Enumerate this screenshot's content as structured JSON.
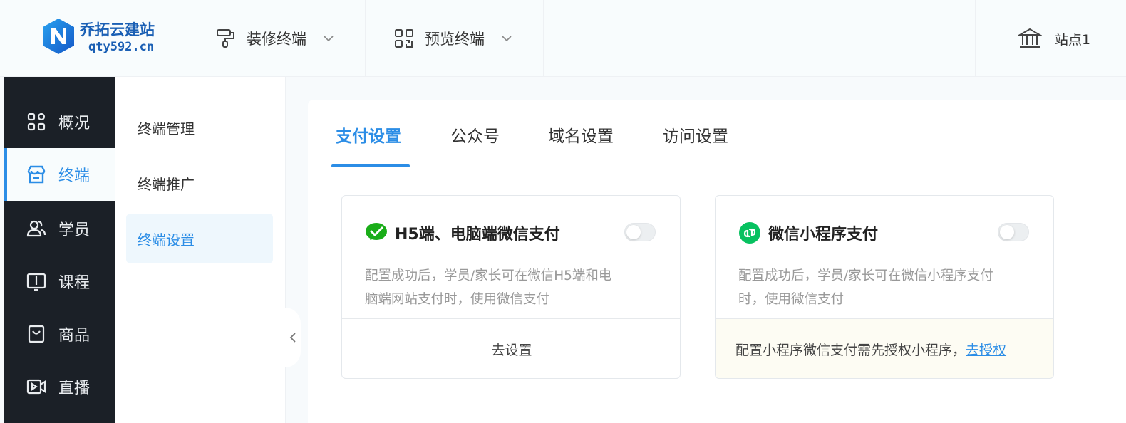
{
  "brand": {
    "title": "乔拓云建站",
    "url": "qty592.cn"
  },
  "header": {
    "menus": [
      {
        "label": "装修终端",
        "icon": "paint-roller-icon"
      },
      {
        "label": "预览终端",
        "icon": "qr-code-icon"
      }
    ],
    "site": {
      "label": "站点1",
      "icon": "bank-building-icon"
    }
  },
  "sidebar": {
    "items": [
      {
        "label": "概况",
        "icon": "dashboard-grid-icon"
      },
      {
        "label": "终端",
        "icon": "store-icon",
        "active": true
      },
      {
        "label": "学员",
        "icon": "users-icon"
      },
      {
        "label": "课程",
        "icon": "book-icon"
      },
      {
        "label": "商品",
        "icon": "shopping-bag-icon"
      },
      {
        "label": "直播",
        "icon": "video-camera-icon"
      }
    ]
  },
  "submenu": {
    "items": [
      {
        "label": "终端管理"
      },
      {
        "label": "终端推广"
      },
      {
        "label": "终端设置",
        "active": true
      }
    ]
  },
  "tabs": [
    {
      "label": "支付设置",
      "active": true
    },
    {
      "label": "公众号"
    },
    {
      "label": "域名设置"
    },
    {
      "label": "访问设置"
    }
  ],
  "cards": {
    "h5": {
      "title": "H5端、电脑端微信支付",
      "icon": "wechat-pay-icon",
      "desc_line1": "配置成功后，学员/家长可在微信H5端和电",
      "desc_line2": "脑端网站支付时，使用微信支付",
      "enabled": false,
      "action": "去设置"
    },
    "mini": {
      "title": "微信小程序支付",
      "icon": "mini-program-icon",
      "desc_line1": "配置成功后，学员/家长可在微信小程序支付",
      "desc_line2": "时，使用微信支付",
      "enabled": false,
      "notice": "配置小程序微信支付需先授权小程序，",
      "link": "去授权"
    }
  },
  "colors": {
    "accent": "#2b8de6",
    "sidebar_bg": "#1b2027",
    "wechat_green": "#1aad19",
    "mini_green": "#07c160"
  }
}
